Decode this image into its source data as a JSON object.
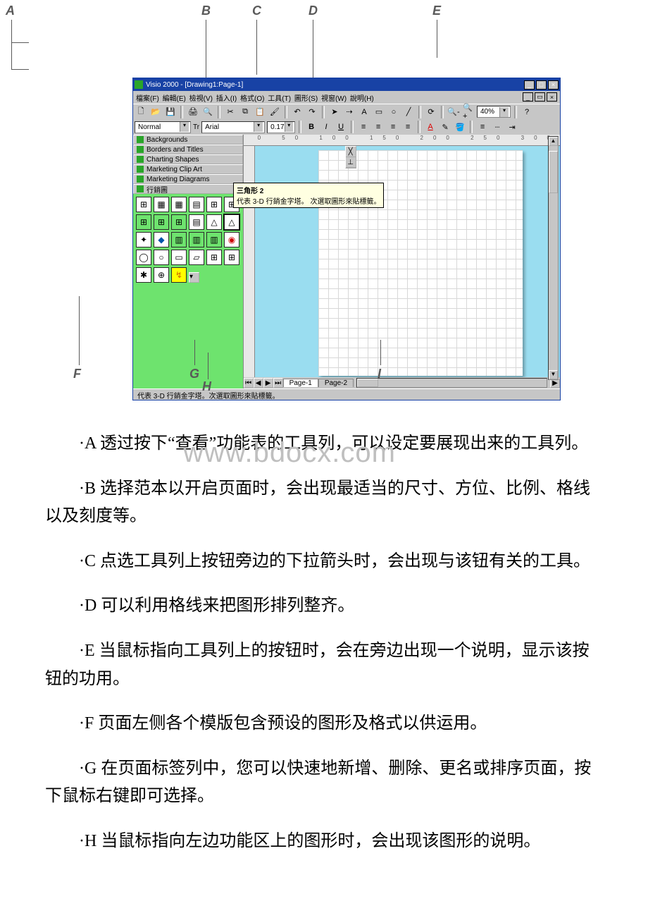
{
  "callout": {
    "A": "A",
    "B": "B",
    "C": "C",
    "D": "D",
    "E": "E",
    "F": "F",
    "G": "G",
    "H": "H",
    "I": "I"
  },
  "visio": {
    "title": "Visio 2000 - [Drawing1:Page-1]",
    "menus": [
      "檔案(F)",
      "編輯(E)",
      "檢視(V)",
      "插入(I)",
      "格式(O)",
      "工具(T)",
      "圖形(S)",
      "視窗(W)",
      "說明(H)"
    ],
    "zoom": "40%",
    "style_name": "Normal",
    "font_name": "Arial",
    "font_size": "0.17",
    "stencils": [
      "Backgrounds",
      "Borders and Titles",
      "Charting Shapes",
      "Marketing Clip Art",
      "Marketing Diagrams",
      "行銷圖"
    ],
    "tooltip_title": "三角形 2",
    "tooltip_body": "代表 3-D 行銷金字塔。\\n次選取圖形來貼標籤。",
    "page_tabs": [
      "Page-1",
      "Page-2"
    ],
    "status": "代表 3-D 行銷金字塔。次選取圖形來貼標籤。"
  },
  "watermark": "www.bdocx.com",
  "paragraphs": {
    "A": "·A 透过按下“查看”功能表的工具列，可以设定要展现出来的工具列。",
    "B": "·B 选择范本以开启页面时，会出现最适当的尺寸、方位、比例、格线以及刻度等。",
    "C": "·C 点选工具列上按钮旁边的下拉箭头时，会出现与该钮有关的工具。",
    "D": "·D 可以利用格线来把图形排列整齐。",
    "E": "·E 当鼠标指向工具列上的按钮时，会在旁边出现一个说明，显示该按钮的功用。",
    "F": "·F 页面左侧各个模版包含预设的图形及格式以供运用。",
    "G": "·G 在页面标签列中，您可以快速地新增、删除、更名或排序页面，按下鼠标右键即可选择。",
    "H": "·H 当鼠标指向左边功能区上的图形时，会出现该图形的说明。"
  }
}
